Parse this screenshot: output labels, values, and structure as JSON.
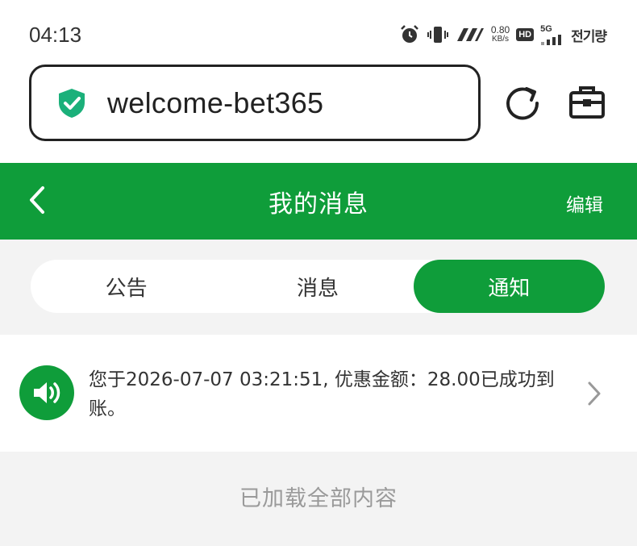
{
  "status_bar": {
    "time": "04:13",
    "speed_value": "0.80",
    "speed_unit": "KB/s",
    "hd_label": "HD",
    "network_label": "5G",
    "carrier_text": "전기량"
  },
  "browser": {
    "url": "welcome-bet365"
  },
  "header": {
    "title": "我的消息",
    "edit_label": "编辑"
  },
  "tabs": [
    {
      "label": "公告",
      "active": false
    },
    {
      "label": "消息",
      "active": false
    },
    {
      "label": "通知",
      "active": true
    }
  ],
  "notice": {
    "text": "您于2026-07-07 03:21:51, 优惠金额：28.00已成功到账。"
  },
  "footer": {
    "text": "已加载全部内容"
  },
  "colors": {
    "primary_green": "#0f9d3a",
    "shield_teal": "#1bb07a",
    "background_gray": "#f3f3f3"
  },
  "icons": {
    "status": [
      "alarm-icon",
      "vibrate-icon",
      "signal-strength-icon"
    ],
    "browser": [
      "shield-check-icon",
      "reload-icon",
      "toolbox-icon"
    ],
    "header": [
      "back-arrow-icon"
    ],
    "notice": [
      "speaker-icon",
      "chevron-right-icon"
    ]
  }
}
